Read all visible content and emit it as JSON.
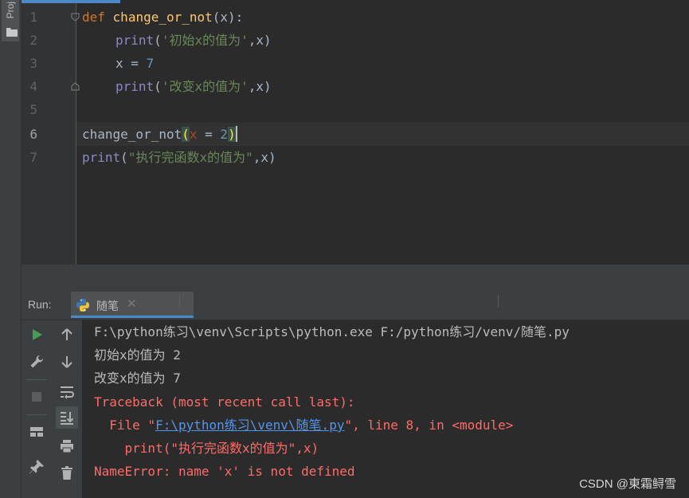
{
  "project_panel": {
    "label": "Proj"
  },
  "editor": {
    "line_numbers": [
      "1",
      "2",
      "3",
      "4",
      "5",
      "6",
      "7"
    ],
    "code": {
      "l1": {
        "kw": "def",
        "fn": "change_or_not",
        "rest": "(x):"
      },
      "l2": {
        "fn": "print",
        "open": "(",
        "str": "'初始x的值为'",
        "rest": ",x)"
      },
      "l3": {
        "var": "x = ",
        "num": "7"
      },
      "l4": {
        "fn": "print",
        "open": "(",
        "str": "'改变x的值为'",
        "rest": ",x)"
      },
      "l6": {
        "name": "change_or_not",
        "open": "(",
        "param": "x",
        "eq": " = ",
        "num": "2",
        "close": ")"
      },
      "l7": {
        "fn": "print",
        "open": "(",
        "str": "\"执行完函数x的值为\"",
        "rest": ",x)"
      }
    }
  },
  "run": {
    "label": "Run:",
    "tab_label": "随笔",
    "tab_close": "✕"
  },
  "console": {
    "lines": [
      {
        "type": "normal",
        "text": "F:\\python练习\\venv\\Scripts\\python.exe F:/python练习/venv/随笔.py"
      },
      {
        "type": "normal",
        "text": "初始x的值为 2"
      },
      {
        "type": "normal",
        "text": "改变x的值为 7"
      },
      {
        "type": "error",
        "text": "Traceback (most recent call last):"
      },
      {
        "type": "error-link",
        "prefix": "  File \"",
        "link": "F:\\python练习\\venv\\随笔.py",
        "suffix": "\", line 8, in <module>"
      },
      {
        "type": "error",
        "text": "    print(\"执行完函数x的值为\",x)"
      },
      {
        "type": "error",
        "text": "NameError: name 'x' is not defined"
      }
    ]
  },
  "watermark": "CSDN @東霜鲟雪",
  "colors": {
    "editor_bg": "#2b2b2b",
    "keyword": "#cc7832",
    "function": "#ffc66d",
    "string": "#6a8759",
    "number": "#6897bb",
    "error": "#ff6b68",
    "link": "#5394ec",
    "run_green": "#499c54"
  },
  "icons": [
    "folder-icon",
    "fold-marker-icon",
    "python-icon",
    "rerun-icon",
    "wrench-icon",
    "stop-icon",
    "layout-icon",
    "pin-icon",
    "up-arrow-icon",
    "down-arrow-icon",
    "soft-wrap-icon",
    "scroll-to-end-icon",
    "print-icon",
    "trash-icon"
  ]
}
